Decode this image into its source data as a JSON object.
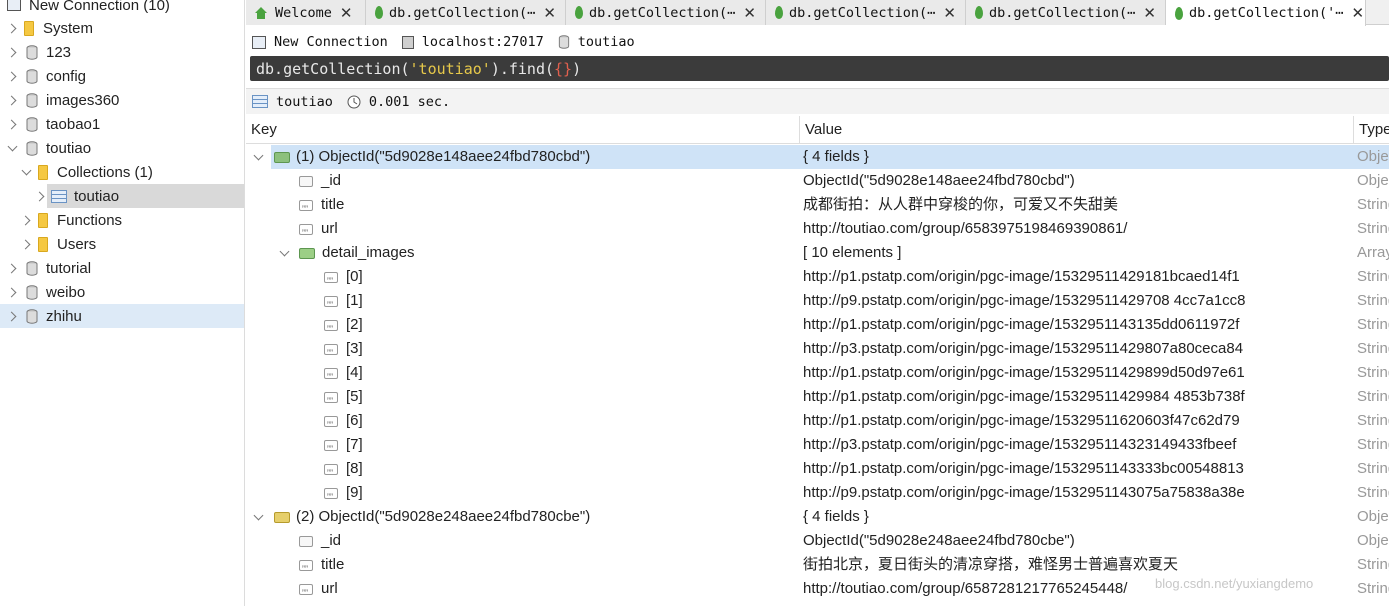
{
  "sidebar": {
    "root_label": "New Connection (10)",
    "databases": [
      {
        "label": "System"
      },
      {
        "label": "123"
      },
      {
        "label": "config"
      },
      {
        "label": "images360"
      },
      {
        "label": "taobao1"
      },
      {
        "label": "toutiao"
      },
      {
        "label": "tutorial"
      },
      {
        "label": "weibo"
      },
      {
        "label": "zhihu"
      }
    ],
    "toutiao_children": {
      "collections_label": "Collections (1)",
      "collection_item": "toutiao",
      "functions_label": "Functions",
      "users_label": "Users"
    }
  },
  "tabs": [
    {
      "label": "Welcome",
      "close": "✕"
    },
    {
      "label": "db.getCollection(⋯",
      "close": "✕"
    },
    {
      "label": "db.getCollection(⋯",
      "close": "✕"
    },
    {
      "label": "db.getCollection(⋯",
      "close": "✕"
    },
    {
      "label": "db.getCollection(⋯",
      "close": "✕"
    },
    {
      "label": "db.getCollection('⋯",
      "close": "✕"
    }
  ],
  "connection": {
    "name": "New Connection",
    "host": "localhost:27017",
    "database": "toutiao"
  },
  "query": {
    "prefix": "db.getCollection(",
    "collection_arg": "'toutiao'",
    "middle": ").find(",
    "braces": "{}",
    "suffix": ")"
  },
  "result_info": {
    "collection": "toutiao",
    "duration": "0.001 sec."
  },
  "grid": {
    "columns": {
      "key": "Key",
      "value": "Value",
      "type": "Type"
    },
    "rows": [
      {
        "key": "(1) ObjectId(\"5d9028e148aee24fbd780cbd\")",
        "value": "{ 4 fields }",
        "type": "Object"
      },
      {
        "key": "_id",
        "value": "ObjectId(\"5d9028e148aee24fbd780cbd\")",
        "type": "ObjectId"
      },
      {
        "key": "title",
        "value": "成都街拍：从人群中穿梭的你，可爱又不失甜美",
        "type": "String"
      },
      {
        "key": "url",
        "value": "http://toutiao.com/group/6583975198469390861/",
        "type": "String"
      },
      {
        "key": "detail_images",
        "value": "[ 10 elements ]",
        "type": "Array"
      },
      {
        "key": "[0]",
        "value": "http://p1.pstatp.com/origin/pgc-image/15329511429181bcaed14f1",
        "type": "String"
      },
      {
        "key": "[1]",
        "value": "http://p9.pstatp.com/origin/pgc-image/15329511429708 4cc7a1cc8",
        "type": "String"
      },
      {
        "key": "[2]",
        "value": "http://p1.pstatp.com/origin/pgc-image/1532951143135dd0611972f",
        "type": "String"
      },
      {
        "key": "[3]",
        "value": "http://p3.pstatp.com/origin/pgc-image/15329511429807a80ceca84",
        "type": "String"
      },
      {
        "key": "[4]",
        "value": "http://p1.pstatp.com/origin/pgc-image/15329511429899d50d97e61",
        "type": "String"
      },
      {
        "key": "[5]",
        "value": "http://p1.pstatp.com/origin/pgc-image/15329511429984 4853b738f",
        "type": "String"
      },
      {
        "key": "[6]",
        "value": "http://p1.pstatp.com/origin/pgc-image/15329511620603f47c62d79",
        "type": "String"
      },
      {
        "key": "[7]",
        "value": "http://p3.pstatp.com/origin/pgc-image/153295114323149433fbeef",
        "type": "String"
      },
      {
        "key": "[8]",
        "value": "http://p1.pstatp.com/origin/pgc-image/1532951143333bc00548813",
        "type": "String"
      },
      {
        "key": "[9]",
        "value": "http://p9.pstatp.com/origin/pgc-image/1532951143075a75838a38e",
        "type": "String"
      },
      {
        "key": "(2) ObjectId(\"5d9028e248aee24fbd780cbe\")",
        "value": "{ 4 fields }",
        "type": "Object"
      },
      {
        "key": "_id",
        "value": "ObjectId(\"5d9028e248aee24fbd780cbe\")",
        "type": "ObjectId"
      },
      {
        "key": "title",
        "value": "街拍北京，夏日街头的清凉穿搭，难怪男士普遍喜欢夏天",
        "type": "String"
      },
      {
        "key": "url",
        "value": "http://toutiao.com/group/6587281217765245448/",
        "type": "String"
      }
    ]
  },
  "watermark": "blog.csdn.net/yuxiangdemo"
}
